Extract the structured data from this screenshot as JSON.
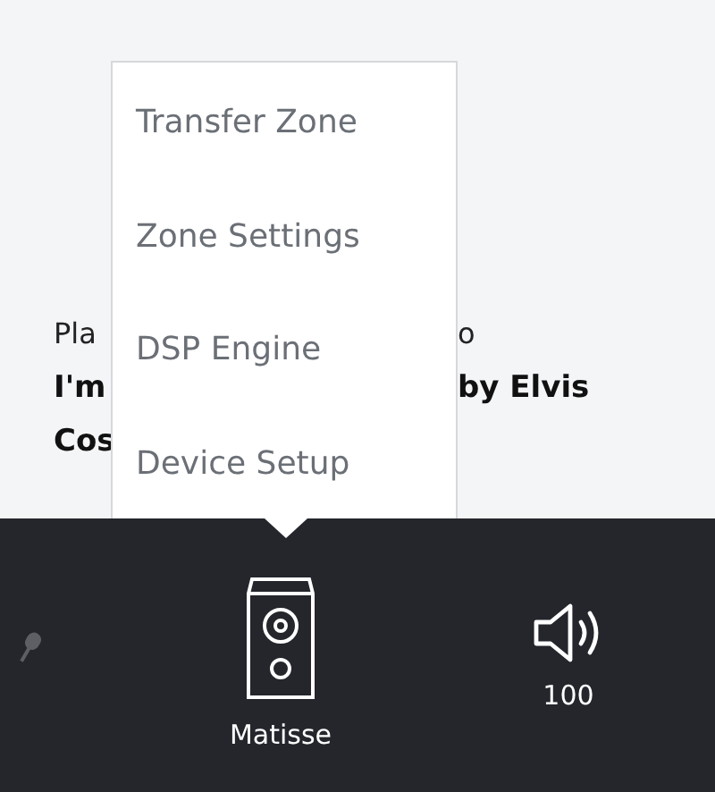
{
  "now_playing": {
    "lines": [
      {
        "left": "Pla",
        "right": "o",
        "bold": false
      },
      {
        "left": "I'm",
        "right": "by Elvis",
        "bold": true
      },
      {
        "left": "Cos",
        "bold": true
      }
    ]
  },
  "menu": {
    "items": [
      {
        "label": "Transfer Zone"
      },
      {
        "label": "Zone Settings"
      },
      {
        "label": "DSP Engine"
      },
      {
        "label": "Device Setup"
      }
    ]
  },
  "footer": {
    "microphone": {
      "disabled": true
    },
    "zone": {
      "label": "Matisse"
    },
    "volume": {
      "label": "100"
    }
  }
}
